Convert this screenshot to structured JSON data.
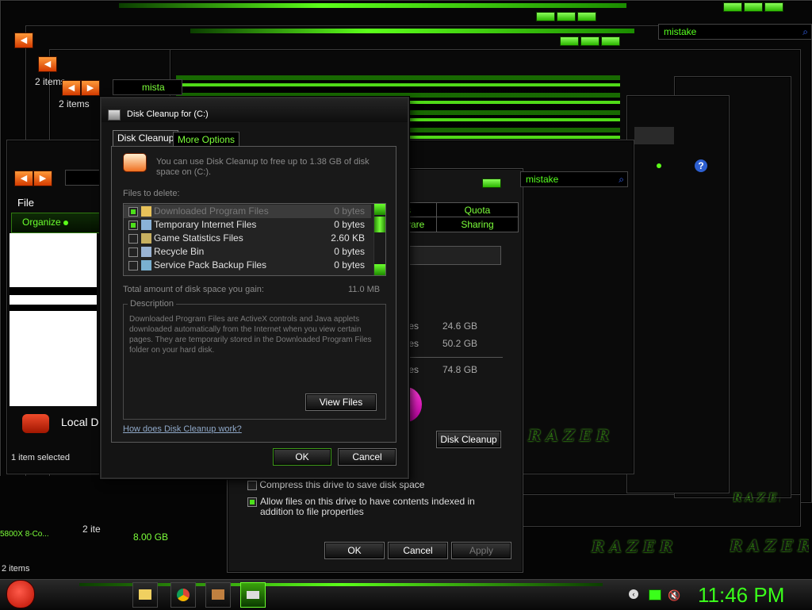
{
  "background": {
    "search_texts": [
      "mistake",
      "mistake",
      "mistake"
    ],
    "explorer": {
      "menu_file": "File",
      "organize": "Organize",
      "drive_label": "Local D",
      "status": "1 item selected",
      "items_count_a": "2 items",
      "items_count_b": "2 items",
      "items_count_c": "2 ite",
      "items_count_d": "2 items",
      "drive_size": "8.00 GB",
      "gpu_label": "5800X 8-Co..."
    },
    "properties": {
      "tabs": [
        "Quota",
        "Sharing"
      ],
      "tab_partial": [
        "s",
        "vare"
      ],
      "rows": [
        {
          "label": "tes",
          "value": "24.6 GB"
        },
        {
          "label": "tes",
          "value": "50.2 GB"
        },
        {
          "label": "tes",
          "value": "74.8 GB"
        }
      ],
      "disk_cleanup_button": "Disk Cleanup",
      "compress_label": "Compress this drive to save disk space",
      "index_label": "Allow files on this drive to have contents indexed in addition to file properties",
      "ok": "OK",
      "cancel": "Cancel",
      "apply": "Apply"
    },
    "brand_text": "RAZER"
  },
  "dialog": {
    "title": "Disk Cleanup for  (C:)",
    "tabs": [
      "Disk Cleanup",
      "More Options"
    ],
    "intro": "You can use Disk Cleanup to free up to 1.38 GB of disk space on  (C:).",
    "files_label": "Files to delete:",
    "files": [
      {
        "name": "Downloaded Program Files",
        "size": "0 bytes",
        "checked": true
      },
      {
        "name": "Temporary Internet Files",
        "size": "0 bytes",
        "checked": true
      },
      {
        "name": "Game Statistics Files",
        "size": "2.60 KB",
        "checked": false
      },
      {
        "name": "Recycle Bin",
        "size": "0 bytes",
        "checked": false
      },
      {
        "name": "Service Pack Backup Files",
        "size": "0 bytes",
        "checked": false
      }
    ],
    "total_label": "Total amount of disk space you gain:",
    "total_value": "11.0 MB",
    "description_legend": "Description",
    "description_text": "Downloaded Program Files are ActiveX controls and Java applets downloaded automatically from the Internet when you view certain pages. They are temporarily stored in the Downloaded Program Files folder on your hard disk.",
    "view_files": "View Files",
    "help_link": "How does Disk Cleanup work?",
    "ok": "OK",
    "cancel": "Cancel"
  },
  "taskbar": {
    "clock": "11:46 PM"
  },
  "colors": {
    "accent": "#5cff1a",
    "dialog_bg": "#141414"
  }
}
